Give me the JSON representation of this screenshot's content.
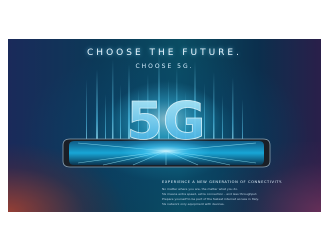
{
  "banner": {
    "headline": "CHOOSE THE FUTURE.",
    "subheadline": "CHOOSE 5G.",
    "logo_text": "5G",
    "caption": {
      "title": "EXPERIENCE A NEW GENERATION OF CONNECTIVITY.",
      "lines": [
        "No matter where you are, the matter what you do.",
        "5G means extra speed, extra connection - and less throughput.",
        "Prepare yourself to be part of the fastest internet access in Italy.",
        "5G network only equipment with devices."
      ]
    },
    "colors": {
      "glow": "#35c8ff",
      "deep_blue": "#0b3a58",
      "warm_corner": "#be4628"
    }
  }
}
